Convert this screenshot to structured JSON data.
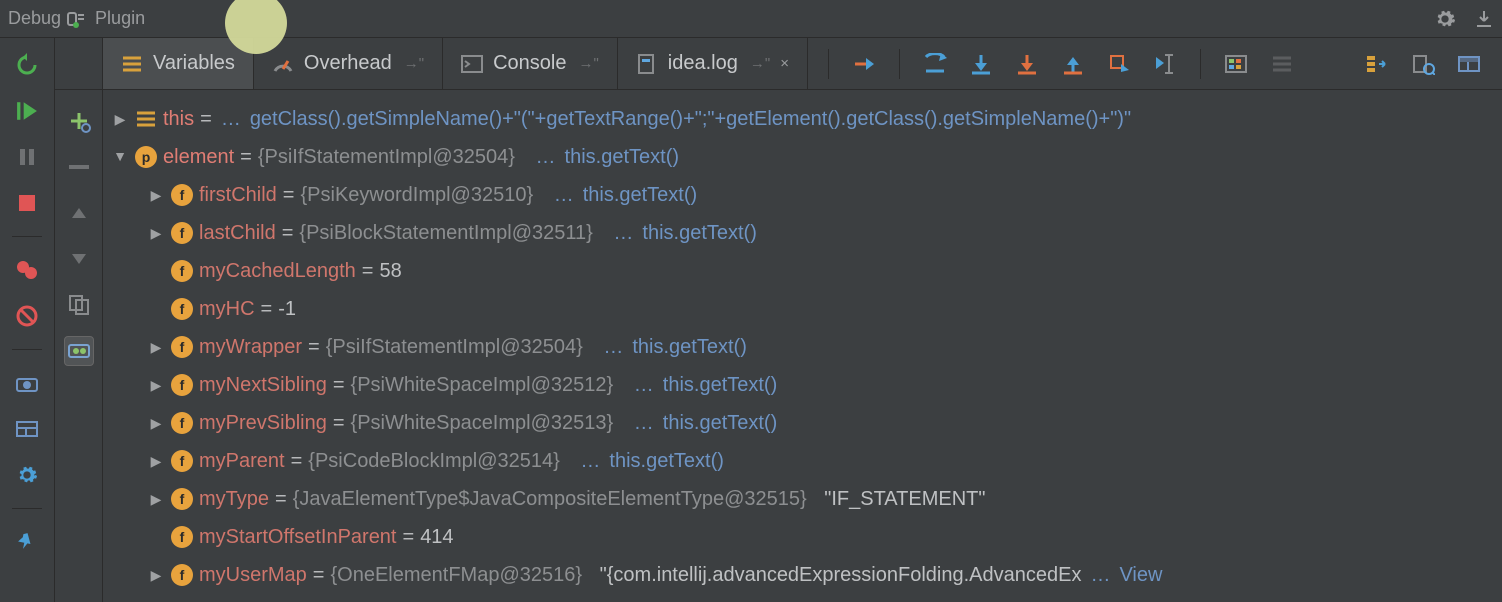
{
  "titlebar": {
    "debug_label": "Debug",
    "config_name": "Plugin"
  },
  "tabs": {
    "variables": "Variables",
    "overhead": "Overhead",
    "console": "Console",
    "idealog": "idea.log",
    "pin_glyph": "→\"",
    "close_glyph": "×"
  },
  "tree": {
    "this_label": "this",
    "this_eq": "=",
    "this_ellipsis": "…",
    "this_expr": "getClass().getSimpleName()+\"(\"+getTextRange()+\";\"+getElement().getClass().getSimpleName()+\")\"",
    "element": {
      "name": "element",
      "eq": " = ",
      "value": "{PsiIfStatementImpl@32504}",
      "ellipsis": "…",
      "suffix": "this.getText()"
    },
    "fields": [
      {
        "expand": true,
        "name": "firstChild",
        "value": "{PsiKeywordImpl@32510}",
        "suffix": "this.getText()"
      },
      {
        "expand": true,
        "name": "lastChild",
        "value": "{PsiBlockStatementImpl@32511}",
        "suffix": "this.getText()"
      },
      {
        "expand": false,
        "name": "myCachedLength",
        "plain": "58"
      },
      {
        "expand": false,
        "name": "myHC",
        "plain": "-1"
      },
      {
        "expand": true,
        "name": "myWrapper",
        "value": "{PsiIfStatementImpl@32504}",
        "suffix": "this.getText()"
      },
      {
        "expand": true,
        "name": "myNextSibling",
        "value": "{PsiWhiteSpaceImpl@32512}",
        "suffix": "this.getText()"
      },
      {
        "expand": true,
        "name": "myPrevSibling",
        "value": "{PsiWhiteSpaceImpl@32513}",
        "suffix": "this.getText()"
      },
      {
        "expand": true,
        "name": "myParent",
        "value": "{PsiCodeBlockImpl@32514}",
        "suffix": "this.getText()"
      },
      {
        "expand": true,
        "name": "myType",
        "value": "{JavaElementType$JavaCompositeElementType@32515}",
        "string": "\"IF_STATEMENT\""
      },
      {
        "expand": false,
        "name": "myStartOffsetInParent",
        "plain": "414"
      },
      {
        "expand": true,
        "name": "myUserMap",
        "value": "{OneElementFMap@32516}",
        "string_trunc": "\"{com.intellij.advancedExpressionFolding.AdvancedEx",
        "tail_link": "View"
      }
    ],
    "ellipsis": "…",
    "eq": " = "
  }
}
